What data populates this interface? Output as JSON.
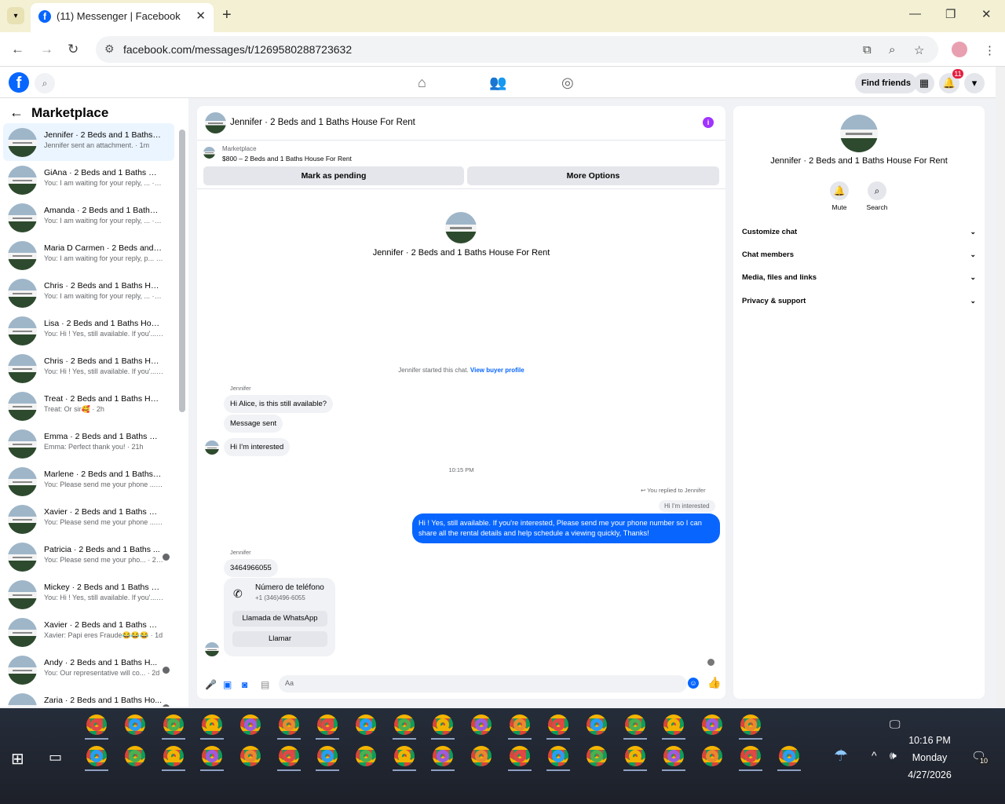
{
  "browser": {
    "tab_title": "(11) Messenger | Facebook",
    "url": "facebook.com/messages/t/1269580288723632",
    "new_tab": "+",
    "close_tab": "✕"
  },
  "fb": {
    "find_friends": "Find friends",
    "notification_count": "11"
  },
  "sidebar": {
    "title": "Marketplace",
    "conversations": [
      {
        "name": "Jennifer · 2 Beds and 1 Baths H...",
        "preview": "Jennifer sent an attachment. · 1m",
        "selected": true
      },
      {
        "name": "GiAna · 2 Beds and 1 Baths Hou...",
        "preview": "You: I am waiting for your reply, ...  · 1m"
      },
      {
        "name": "Amanda · 2 Beds and 1 Baths H...",
        "preview": "You: I am waiting for your reply, ...  · 1m"
      },
      {
        "name": "Maria D Carmen · 2 Beds and 1 ...",
        "preview": "You: I am waiting for your reply, p... · 1m"
      },
      {
        "name": "Chris · 2 Beds and 1 Baths Hous...",
        "preview": "You: I am waiting for your reply, ...  · 1m"
      },
      {
        "name": "Lisa · 2 Beds and 1 Baths House...",
        "preview": "You: Hi ! Yes, still available. If you'... · 1m"
      },
      {
        "name": "Chris · 2 Beds and 1 Baths Hous...",
        "preview": "You: Hi ! Yes, still available. If you'... · 1m"
      },
      {
        "name": "Treat · 2 Beds and 1 Baths House...",
        "preview": "Treat: Or sir🥰 · 2h"
      },
      {
        "name": "Emma · 2 Beds and 1 Baths Ho...",
        "preview": "Emma: Perfect thank you! · 21h"
      },
      {
        "name": "Marlene · 2 Beds and 1 Baths H...",
        "preview": "You: Please send me your phone ... · 22h"
      },
      {
        "name": "Xavier · 2 Beds and 1 Baths Ho...",
        "preview": "You: Please send me your phone ... · 22h"
      },
      {
        "name": "Patricia · 2 Beds and 1 Baths ...",
        "preview": "You: Please send me your pho... · 22h",
        "dot": true
      },
      {
        "name": "Mickey · 2 Beds and 1 Baths Ho...",
        "preview": "You: Hi ! Yes, still available. If you'... · 22h"
      },
      {
        "name": "Xavier · 2 Beds and 1 Baths Ho...",
        "preview": "Xavier: Papi eres Fraude😂😂😂 · 1d"
      },
      {
        "name": "Andy · 2 Beds and 1 Baths H...",
        "preview": "You: Our representative will co... · 2d",
        "dot": true
      },
      {
        "name": "Zaria · 2 Beds and 1 Baths Ho...",
        "preview": "",
        "dot": true
      }
    ]
  },
  "chat": {
    "title": "Jennifer · 2 Beds and 1 Baths House For Rent",
    "marketplace_label": "Marketplace",
    "listing": "$800 – 2 Beds and 1 Baths House For Rent",
    "mark_pending": "Mark as pending",
    "more_options": "More Options",
    "profile_name": "Jennifer · 2 Beds and 1 Baths House For Rent",
    "started_text": "Jennifer started this chat.",
    "view_buyer_profile": "View buyer profile",
    "sender": "Jennifer",
    "msg1": "Hi Alice, is this still available?",
    "msg2": "Message sent",
    "msg3": "Hi I'm interested",
    "time": "10:15 PM",
    "you_replied": "You replied to Jennifer",
    "quoted": "Hi I'm interested",
    "my_reply": "Hi ! Yes, still available. If you're interested, Please send me your phone number so I can share all the rental details and help schedule a viewing quickly, Thanks!",
    "sender2": "Jennifer",
    "phone_msg": "3464966055",
    "card_title": "Número de teléfono",
    "card_phone": "+1 (346)496-6055",
    "whatsapp": "Llamada de WhatsApp",
    "call": "Llamar",
    "composer_placeholder": "Aa"
  },
  "info": {
    "name": "Jennifer · 2 Beds and 1 Baths House For Rent",
    "mute": "Mute",
    "search": "Search",
    "customize": "Customize chat",
    "members": "Chat members",
    "media": "Media, files and links",
    "privacy": "Privacy & support"
  },
  "taskbar": {
    "time": "10:16 PM",
    "day": "Monday",
    "date": "4/27/2026",
    "notif_count": "10"
  }
}
